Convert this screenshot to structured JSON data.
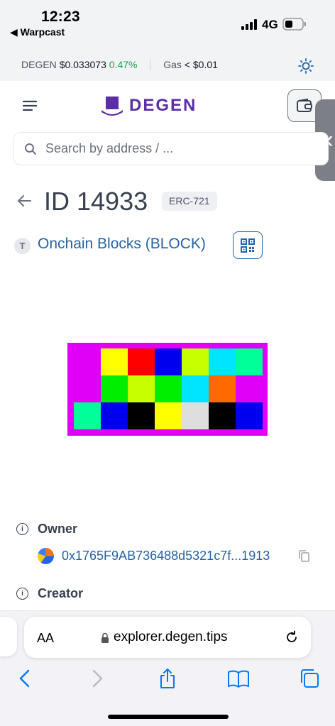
{
  "status_bar": {
    "time": "12:23",
    "back_app": "◀ Warpcast",
    "network": "4G"
  },
  "ticker": {
    "token": "DEGEN",
    "price": "$0.033073",
    "change": "0.47%",
    "gas_label": "Gas",
    "gas_value": "< $0.01"
  },
  "header": {
    "logo_text": "DEGEN"
  },
  "search": {
    "placeholder": "Search by address / ..."
  },
  "token": {
    "title": "ID 14933",
    "standard": "ERC-721",
    "collection_initial": "T",
    "collection_name": "Onchain Blocks (BLOCK)"
  },
  "nft_image": {
    "background": "#e000f5",
    "rows": [
      [
        null,
        "#ffff00",
        "#ff0000",
        "#0000ee",
        "#c8ff00",
        "#00e5ff",
        "#00ff99"
      ],
      [
        null,
        "#00ee00",
        "#c8ff00",
        "#00ee00",
        "#00e5ff",
        "#ff6a00",
        null
      ],
      [
        "#00ff99",
        "#0000ee",
        "#000000",
        "#ffff00",
        "#dedede",
        "#000000",
        "#0000ee"
      ]
    ]
  },
  "details": {
    "owner_label": "Owner",
    "owner_address": "0x1765F9AB736488d5321c7f...1913",
    "creator_label": "Creator"
  },
  "browser": {
    "aa_label": "AA",
    "url": "explorer.degen.tips"
  },
  "colors": {
    "brand": "#5b2ea8",
    "link": "#2563a6",
    "positive": "#16a34a",
    "ios_blue": "#007aff"
  }
}
